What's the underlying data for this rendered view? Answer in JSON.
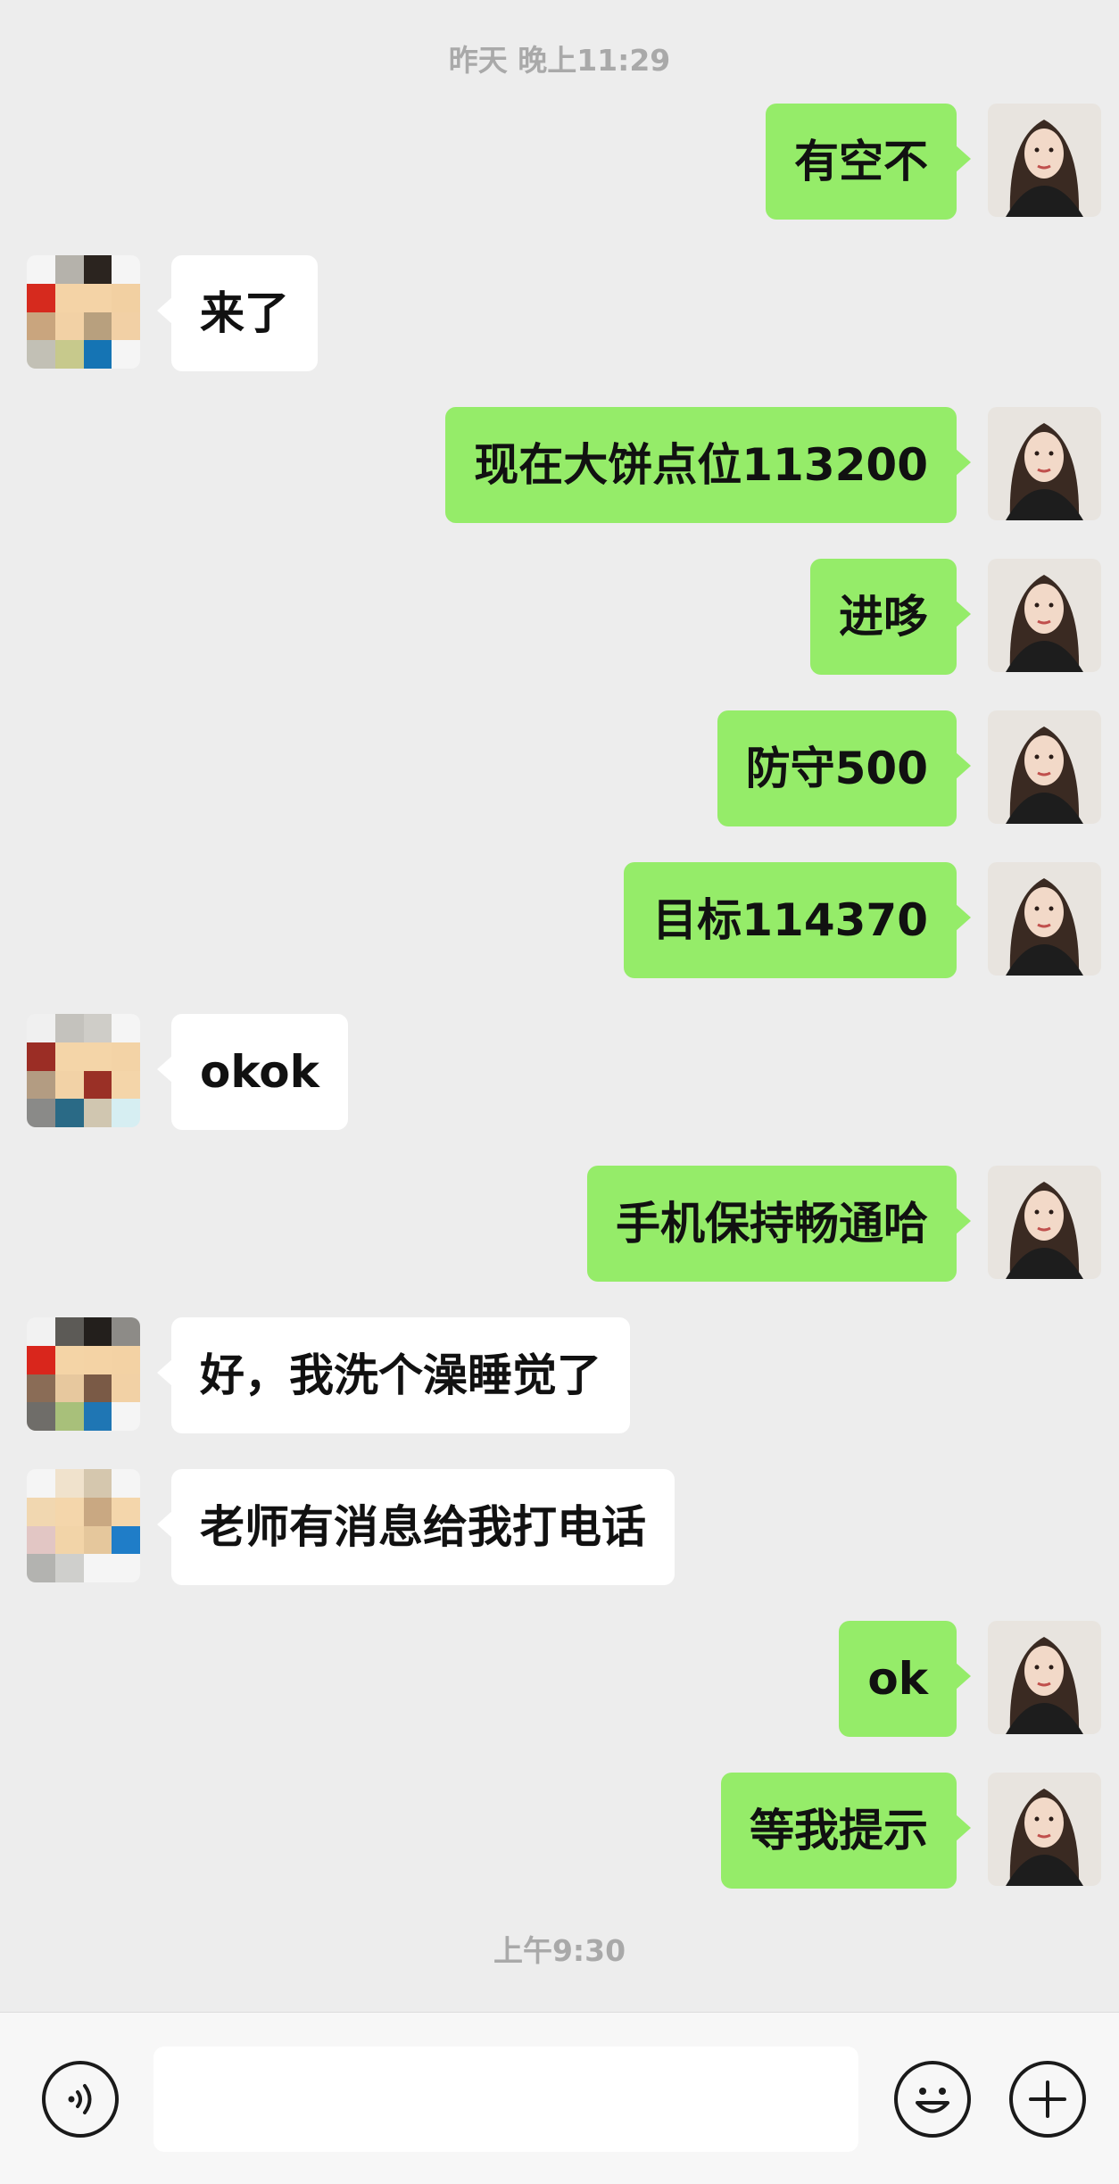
{
  "chat": {
    "timestamp_top": "昨天 晚上11:29",
    "timestamp_bottom": "上午9:30",
    "messages": [
      {
        "side": "right",
        "text": "有空不"
      },
      {
        "side": "left",
        "text": "来了"
      },
      {
        "side": "right",
        "text": "现在大饼点位113200"
      },
      {
        "side": "right",
        "text": "进哆"
      },
      {
        "side": "right",
        "text": "防守500"
      },
      {
        "side": "right",
        "text": "目标114370"
      },
      {
        "side": "left",
        "text": "okok"
      },
      {
        "side": "right",
        "text": "手机保持畅通哈"
      },
      {
        "side": "left",
        "text": "好，我洗个澡睡觉了"
      },
      {
        "side": "left",
        "text": "老师有消息给我打电话"
      },
      {
        "side": "right",
        "text": "ok"
      },
      {
        "side": "right",
        "text": "等我提示"
      }
    ]
  },
  "colors": {
    "sent_bubble": "#95ec69",
    "received_bubble": "#ffffff",
    "background": "#ededed"
  },
  "input_bar": {
    "icons": [
      "voice-icon",
      "emoji-icon",
      "plus-icon"
    ]
  }
}
